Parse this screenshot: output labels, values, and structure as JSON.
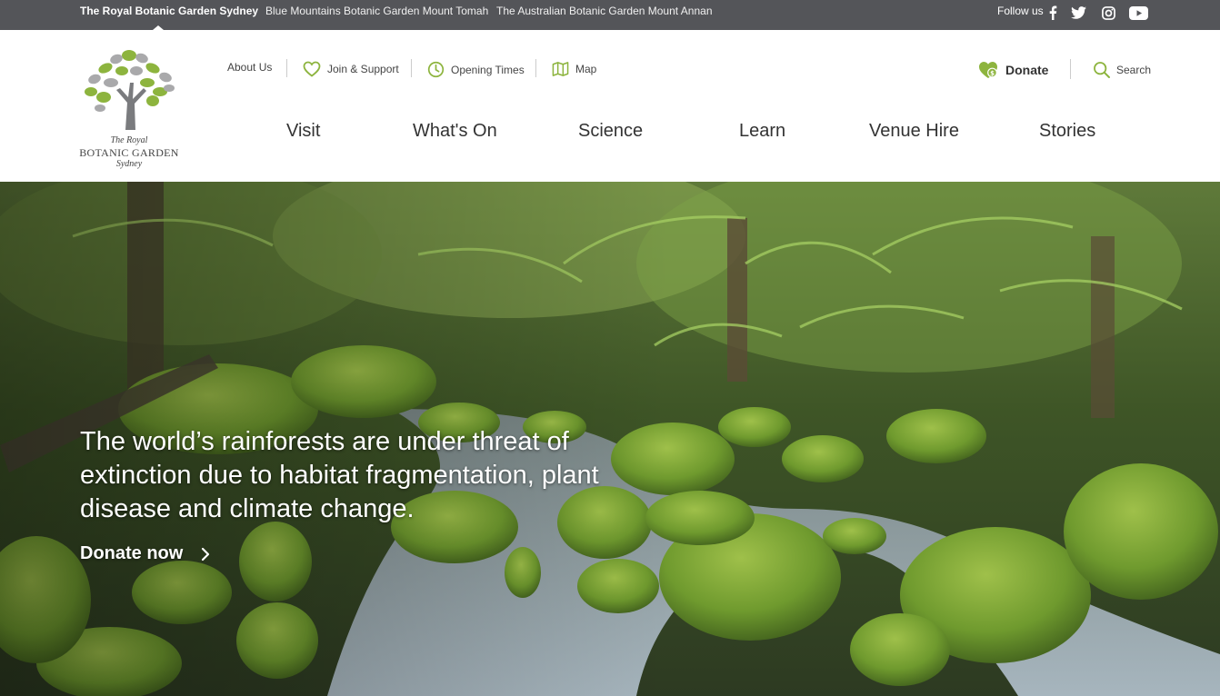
{
  "topbar": {
    "sites": [
      {
        "label": "The Royal Botanic Garden Sydney",
        "active": true
      },
      {
        "label": "Blue Mountains Botanic Garden Mount Tomah",
        "active": false
      },
      {
        "label": "The Australian Botanic Garden Mount Annan",
        "active": false
      }
    ],
    "follow_label": "Follow us",
    "social_icons": [
      "facebook-icon",
      "twitter-icon",
      "instagram-icon",
      "youtube-icon"
    ]
  },
  "logo": {
    "line1": "The Royal",
    "line2": "BOTANIC GARDEN",
    "line3": "Sydney"
  },
  "utility_nav": {
    "about": "About Us",
    "join": "Join & Support",
    "opening": "Opening Times",
    "map": "Map",
    "donate": "Donate",
    "search": "Search"
  },
  "main_nav": [
    "Visit",
    "What's On",
    "Science",
    "Learn",
    "Venue Hire",
    "Stories"
  ],
  "hero": {
    "headline": "The world’s rainforests are under threat of extinction due to habitat fragmentation, plant disease and climate change.",
    "cta": "Donate now"
  },
  "colors": {
    "topbar_bg": "#545559",
    "accent_green": "#8db43e",
    "text_dark": "#333333"
  }
}
